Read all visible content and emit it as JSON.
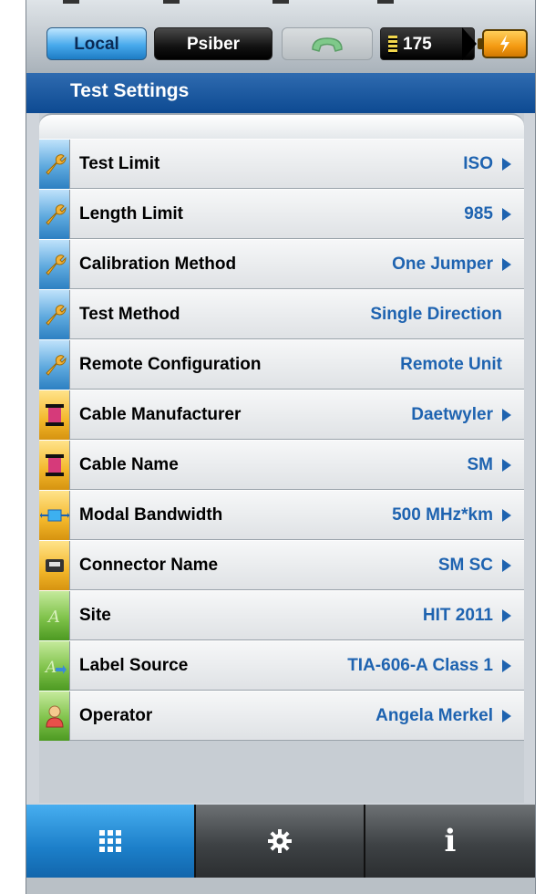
{
  "statusbar": {
    "local_label": "Local",
    "psiber_label": "Psiber",
    "counter_value": "175",
    "phone_icon": "phone-handset-icon",
    "battery_icon": "battery-charging-icon"
  },
  "titlebar": {
    "title": "Test Settings"
  },
  "settings": [
    {
      "label": "Test Limit",
      "value": "ISO",
      "icon": "wrench-icon",
      "arrow": true
    },
    {
      "label": "Length Limit",
      "value": "985",
      "icon": "wrench-icon",
      "arrow": true
    },
    {
      "label": "Calibration Method",
      "value": "One Jumper",
      "icon": "wrench-icon",
      "arrow": true
    },
    {
      "label": "Test Method",
      "value": "Single Direction",
      "icon": "wrench-icon",
      "arrow": false
    },
    {
      "label": "Remote Configuration",
      "value": "Remote Unit",
      "icon": "wrench-icon",
      "arrow": false
    },
    {
      "label": "Cable Manufacturer",
      "value": "Daetwyler",
      "icon": "cable-spool-icon",
      "arrow": true
    },
    {
      "label": "Cable Name",
      "value": "SM",
      "icon": "cable-spool-icon",
      "arrow": true
    },
    {
      "label": "Modal Bandwidth",
      "value": "500 MHz*km",
      "icon": "fiber-link-icon",
      "arrow": true
    },
    {
      "label": "Connector Name",
      "value": "SM SC",
      "icon": "connector-icon",
      "arrow": true
    },
    {
      "label": "Site",
      "value": "HIT 2011",
      "icon": "site-letter-icon",
      "arrow": true
    },
    {
      "label": "Label Source",
      "value": "TIA-606-A Class 1",
      "icon": "label-source-icon",
      "arrow": true
    },
    {
      "label": "Operator",
      "value": "Angela Merkel",
      "icon": "operator-person-icon",
      "arrow": true
    }
  ],
  "bottomnav": {
    "apps_icon": "grid-icon",
    "settings_icon": "gear-icon",
    "info_icon": "info-icon",
    "info_glyph": "i"
  },
  "colors": {
    "accent_blue": "#1e63b0",
    "title_bar": "#1a57a0",
    "battery": "#f49a12"
  }
}
